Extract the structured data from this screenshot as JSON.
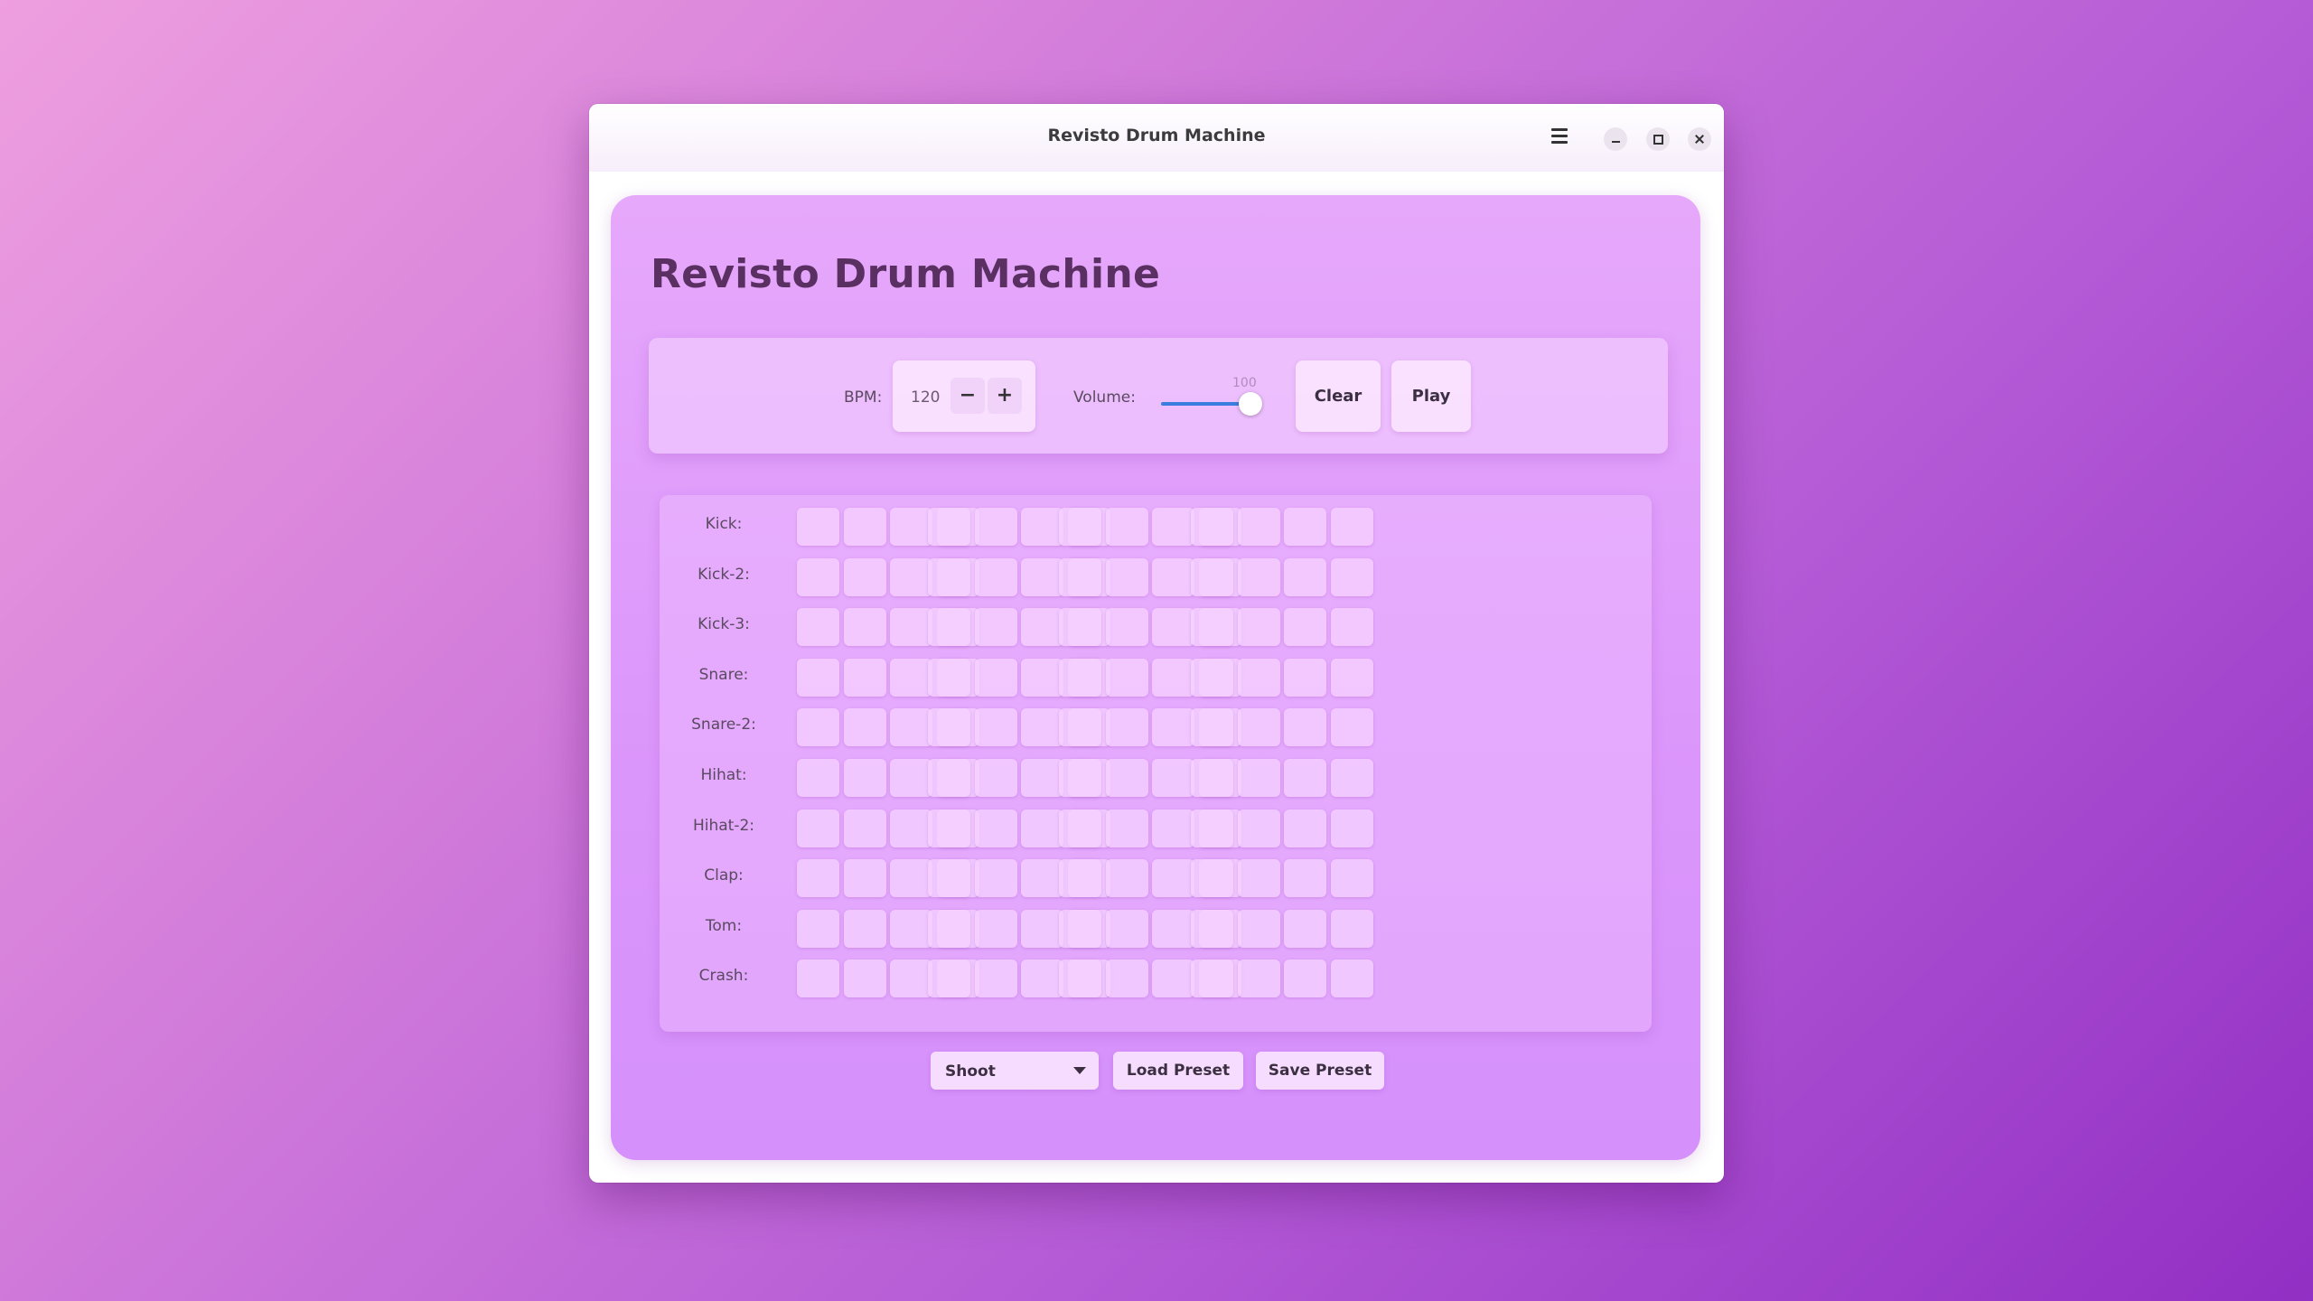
{
  "window": {
    "title": "Revisto Drum Machine"
  },
  "app": {
    "title": "Revisto Drum Machine"
  },
  "toolbar": {
    "bpm_label": "BPM:",
    "bpm_value": "120",
    "minus_label": "−",
    "plus_label": "+",
    "volume_label": "Volume:",
    "volume_value": "100",
    "volume_level": 1.0,
    "clear_label": "Clear",
    "play_label": "Play"
  },
  "tracks": [
    {
      "label": "Kick:",
      "steps": [
        0,
        0,
        0,
        0,
        0,
        0,
        0,
        0,
        0,
        0,
        0,
        0,
        0,
        0,
        0,
        0
      ]
    },
    {
      "label": "Kick-2:",
      "steps": [
        0,
        0,
        0,
        0,
        0,
        0,
        0,
        0,
        0,
        0,
        0,
        0,
        0,
        0,
        0,
        0
      ]
    },
    {
      "label": "Kick-3:",
      "steps": [
        0,
        0,
        0,
        0,
        0,
        0,
        0,
        0,
        0,
        0,
        0,
        0,
        0,
        0,
        0,
        0
      ]
    },
    {
      "label": "Snare:",
      "steps": [
        0,
        0,
        0,
        0,
        0,
        0,
        0,
        0,
        0,
        0,
        0,
        0,
        0,
        0,
        0,
        0
      ]
    },
    {
      "label": "Snare-2:",
      "steps": [
        0,
        0,
        0,
        0,
        0,
        0,
        0,
        0,
        0,
        0,
        0,
        0,
        0,
        0,
        0,
        0
      ]
    },
    {
      "label": "Hihat:",
      "steps": [
        0,
        0,
        0,
        0,
        0,
        0,
        0,
        0,
        0,
        0,
        0,
        0,
        0,
        0,
        0,
        0
      ]
    },
    {
      "label": "Hihat-2:",
      "steps": [
        0,
        0,
        0,
        0,
        0,
        0,
        0,
        0,
        0,
        0,
        0,
        0,
        0,
        0,
        0,
        0
      ]
    },
    {
      "label": "Clap:",
      "steps": [
        0,
        0,
        0,
        0,
        0,
        0,
        0,
        0,
        0,
        0,
        0,
        0,
        0,
        0,
        0,
        0
      ]
    },
    {
      "label": "Tom:",
      "steps": [
        0,
        0,
        0,
        0,
        0,
        0,
        0,
        0,
        0,
        0,
        0,
        0,
        0,
        0,
        0,
        0
      ]
    },
    {
      "label": "Crash:",
      "steps": [
        0,
        0,
        0,
        0,
        0,
        0,
        0,
        0,
        0,
        0,
        0,
        0,
        0,
        0,
        0,
        0
      ]
    }
  ],
  "presets": {
    "selected": "Shoot",
    "load_label": "Load Preset",
    "save_label": "Save Preset"
  },
  "icons": {
    "menu": "hamburger-menu-icon",
    "minimize": "minimize-icon",
    "maximize": "maximize-icon",
    "close": "close-icon",
    "dropdown": "chevron-down-icon"
  },
  "colors": {
    "slider_accent": "#3b7ee0",
    "title_text": "#5a2f62"
  }
}
